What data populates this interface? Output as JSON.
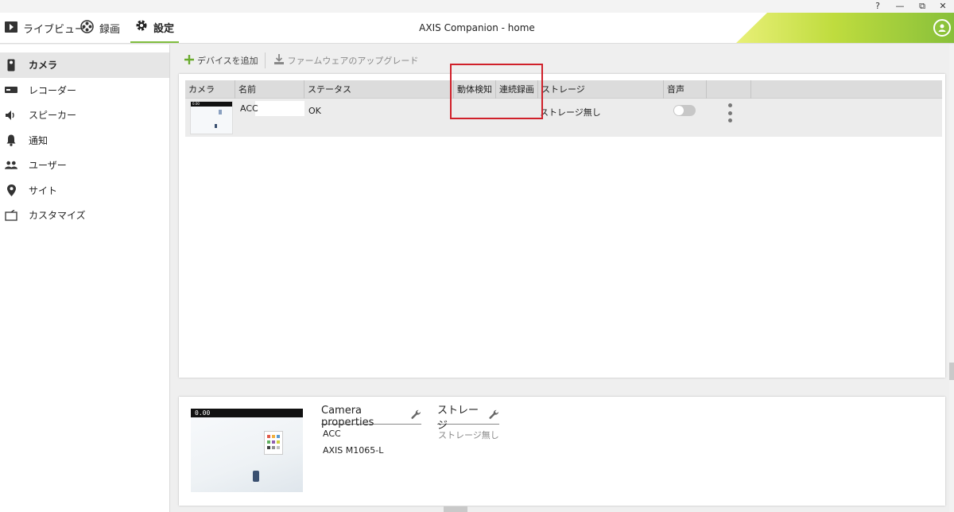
{
  "window": {
    "help": "?",
    "minimize": "—",
    "restore": "⧉",
    "close": "✕"
  },
  "header": {
    "title": "AXIS Companion - home",
    "tabs": [
      {
        "label": "ライブビュー",
        "icon": "play-icon"
      },
      {
        "label": "録画",
        "icon": "film-reel-icon"
      },
      {
        "label": "設定",
        "icon": "gear-icon",
        "active": true
      }
    ],
    "accent_color": "#7fbd3d"
  },
  "sidebar": {
    "items": [
      {
        "label": "カメラ",
        "icon": "camera-icon",
        "active": true
      },
      {
        "label": "レコーダー",
        "icon": "recorder-icon"
      },
      {
        "label": "スピーカー",
        "icon": "speaker-icon"
      },
      {
        "label": "通知",
        "icon": "bell-icon"
      },
      {
        "label": "ユーザー",
        "icon": "users-icon"
      },
      {
        "label": "サイト",
        "icon": "location-pin-icon"
      },
      {
        "label": "カスタマイズ",
        "icon": "customize-icon"
      }
    ]
  },
  "toolbar": {
    "add_device": "デバイスを追加",
    "firmware_upgrade": "ファームウェアのアップグレード"
  },
  "table": {
    "columns": [
      "カメラ",
      "名前",
      "ステータス",
      "動体検知",
      "連続録画",
      "ストレージ",
      "音声"
    ],
    "rows": [
      {
        "name": "ACC",
        "status": "OK",
        "motion_detection": "",
        "continuous_recording": "",
        "storage": "ストレージ無し",
        "audio_enabled": false
      }
    ]
  },
  "details": {
    "thumbnail_timestamp": "0.00",
    "camera_properties_title": "Camera properties",
    "camera_name": "ACC",
    "camera_model": "AXIS M1065-L",
    "storage_title": "ストレージ",
    "storage_value": "ストレージ無し"
  },
  "highlight_color": "#d0202a"
}
